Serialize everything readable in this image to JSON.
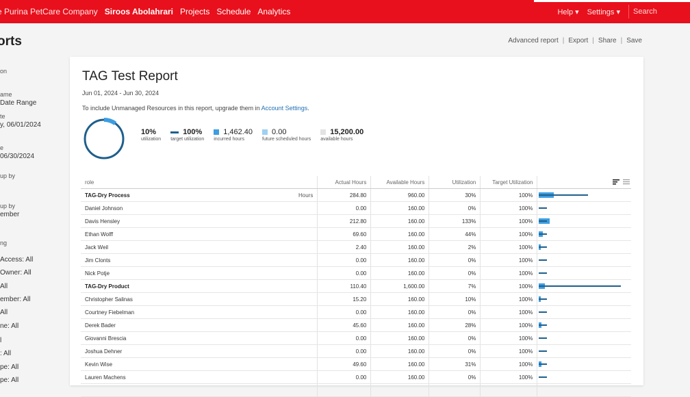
{
  "nav": {
    "company": "e Purina PetCare Company",
    "user": "Siroos Abolahrari",
    "links": [
      "Projects",
      "Schedule",
      "Analytics"
    ],
    "help": "Help ▾",
    "settings": "Settings ▾",
    "search_placeholder": "Search"
  },
  "page_title": "orts",
  "sidebar": [
    {
      "label": "on",
      "value": ""
    },
    {
      "label": "ame",
      "value": "Date Range"
    },
    {
      "label": "te",
      "value": "y, 06/01/2024"
    },
    {
      "label": "e",
      "value": "06/30/2024"
    },
    {
      "label": "up by",
      "value": ""
    },
    {
      "label": "up by",
      "value": "ember"
    },
    {
      "label": "ng",
      "value": ""
    },
    {
      "label": "",
      "value": "Access: All"
    },
    {
      "label": "",
      "value": "Owner: All"
    },
    {
      "label": "",
      "value": "All"
    },
    {
      "label": "",
      "value": "ember: All"
    },
    {
      "label": "",
      "value": "All"
    },
    {
      "label": "",
      "value": "ne: All"
    },
    {
      "label": "",
      "value": "l"
    },
    {
      "label": "",
      "value": ": All"
    },
    {
      "label": "",
      "value": "pe: All"
    },
    {
      "label": "",
      "value": "pe: All"
    }
  ],
  "actions": [
    "Advanced report",
    "Export",
    "Share",
    "Save"
  ],
  "report": {
    "title": "TAG Test Report",
    "daterange": "Jun 01, 2024 - Jun 30, 2024",
    "notice_prefix": "To include Unmanaged Resources in this report, upgrade them in ",
    "notice_link": "Account Settings",
    "notice_suffix": ".",
    "utilization_fraction": 0.1
  },
  "stats": [
    {
      "value": "10%",
      "label": "utilization",
      "marker": "none"
    },
    {
      "value": "100%",
      "label": "target utilization",
      "marker": "line"
    },
    {
      "value": "1,462.40",
      "label": "incurred hours",
      "marker": "dark"
    },
    {
      "value": "0.00",
      "label": "future scheduled hours",
      "marker": "light"
    },
    {
      "value": "15,200.00",
      "label": "available hours",
      "marker": "grey"
    }
  ],
  "colors": {
    "brand": "#e8101c",
    "incurred": "#3d9de0",
    "future": "#9fd0f2",
    "available": "#e3e3e3",
    "target": "#1f5f8b"
  },
  "table": {
    "headers": [
      "role",
      "",
      "Actual Hours",
      "Available Hours",
      "Utilization",
      "Target Utilization"
    ],
    "rows": [
      {
        "role": "TAG-Dry Process",
        "tag": "Hours",
        "actual": "284.80",
        "available": "960.00",
        "util": "30%",
        "target": "100%",
        "group": true,
        "util_frac": 0.3,
        "avail_scale": 0.6
      },
      {
        "role": "Daniel Johnson",
        "tag": "",
        "actual": "0.00",
        "available": "160.00",
        "util": "0%",
        "target": "100%",
        "group": false,
        "util_frac": 0.0,
        "avail_scale": 0.1
      },
      {
        "role": "Davis Hensley",
        "tag": "",
        "actual": "212.80",
        "available": "160.00",
        "util": "133%",
        "target": "100%",
        "group": false,
        "util_frac": 1.33,
        "avail_scale": 0.1
      },
      {
        "role": "Ethan Wolff",
        "tag": "",
        "actual": "69.60",
        "available": "160.00",
        "util": "44%",
        "target": "100%",
        "group": false,
        "util_frac": 0.44,
        "avail_scale": 0.1
      },
      {
        "role": "Jack Weil",
        "tag": "",
        "actual": "2.40",
        "available": "160.00",
        "util": "2%",
        "target": "100%",
        "group": false,
        "util_frac": 0.02,
        "avail_scale": 0.1
      },
      {
        "role": "Jim Clonts",
        "tag": "",
        "actual": "0.00",
        "available": "160.00",
        "util": "0%",
        "target": "100%",
        "group": false,
        "util_frac": 0.0,
        "avail_scale": 0.1
      },
      {
        "role": "Nick Potje",
        "tag": "",
        "actual": "0.00",
        "available": "160.00",
        "util": "0%",
        "target": "100%",
        "group": false,
        "util_frac": 0.0,
        "avail_scale": 0.1
      },
      {
        "role": "TAG-Dry Product",
        "tag": "",
        "actual": "110.40",
        "available": "1,600.00",
        "util": "7%",
        "target": "100%",
        "group": true,
        "util_frac": 0.07,
        "avail_scale": 1.0
      },
      {
        "role": "Christopher Salinas",
        "tag": "",
        "actual": "15.20",
        "available": "160.00",
        "util": "10%",
        "target": "100%",
        "group": false,
        "util_frac": 0.1,
        "avail_scale": 0.1
      },
      {
        "role": "Courtney Fiebelman",
        "tag": "",
        "actual": "0.00",
        "available": "160.00",
        "util": "0%",
        "target": "100%",
        "group": false,
        "util_frac": 0.0,
        "avail_scale": 0.1
      },
      {
        "role": "Derek Bader",
        "tag": "",
        "actual": "45.60",
        "available": "160.00",
        "util": "28%",
        "target": "100%",
        "group": false,
        "util_frac": 0.28,
        "avail_scale": 0.1
      },
      {
        "role": "Giovanni Brescia",
        "tag": "",
        "actual": "0.00",
        "available": "160.00",
        "util": "0%",
        "target": "100%",
        "group": false,
        "util_frac": 0.0,
        "avail_scale": 0.1
      },
      {
        "role": "Joshua Dehner",
        "tag": "",
        "actual": "0.00",
        "available": "160.00",
        "util": "0%",
        "target": "100%",
        "group": false,
        "util_frac": 0.0,
        "avail_scale": 0.1
      },
      {
        "role": "Kevin Wise",
        "tag": "",
        "actual": "49.60",
        "available": "160.00",
        "util": "31%",
        "target": "100%",
        "group": false,
        "util_frac": 0.31,
        "avail_scale": 0.1
      },
      {
        "role": "Lauren Machens",
        "tag": "",
        "actual": "0.00",
        "available": "160.00",
        "util": "0%",
        "target": "100%",
        "group": false,
        "util_frac": 0.0,
        "avail_scale": 0.1
      },
      {
        "role": "",
        "tag": "",
        "actual": "",
        "available": "",
        "util": "",
        "target": "",
        "group": false,
        "util_frac": 0.0,
        "avail_scale": 0.0
      }
    ]
  }
}
